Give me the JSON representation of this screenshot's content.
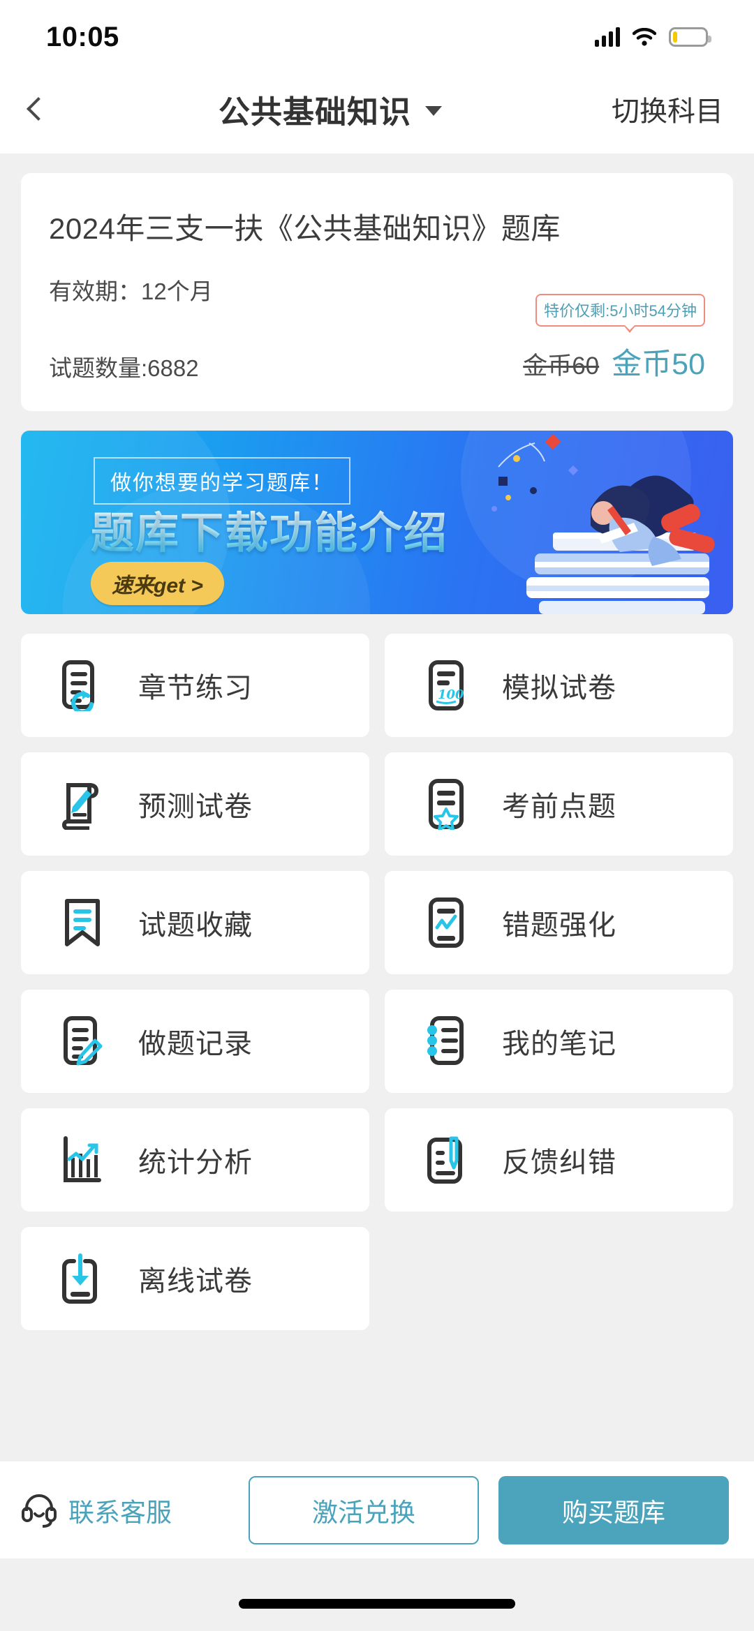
{
  "status_bar": {
    "time": "10:05",
    "signal_icon": "signal-bars-icon",
    "wifi_icon": "wifi-icon",
    "battery_icon": "battery-low-icon"
  },
  "nav": {
    "back_icon": "chevron-left-icon",
    "title": "公共基础知识",
    "dropdown_icon": "caret-down-icon",
    "action_label": "切换科目"
  },
  "info_card": {
    "title": "2024年三支一扶《公共基础知识》题库",
    "validity": "有效期：12个月",
    "question_count": "试题数量:6882",
    "promo_badge": "特价仅剩:5小时54分钟",
    "price_original": "金币60",
    "price_current": "金币50"
  },
  "banner": {
    "tagline": "做你想要的学习题库！",
    "title": "题库下载功能介绍",
    "cta": "速来get >",
    "illustration": "person-studying-on-books-illustration"
  },
  "grid": {
    "items": [
      {
        "label": "章节练习",
        "icon": "document-refresh-icon"
      },
      {
        "label": "模拟试卷",
        "icon": "document-score-100-icon"
      },
      {
        "label": "预测试卷",
        "icon": "scroll-pen-icon"
      },
      {
        "label": "考前点题",
        "icon": "document-star-icon"
      },
      {
        "label": "试题收藏",
        "icon": "bookmark-lines-icon"
      },
      {
        "label": "错题强化",
        "icon": "document-checkline-icon"
      },
      {
        "label": "做题记录",
        "icon": "document-pencil-icon"
      },
      {
        "label": "我的笔记",
        "icon": "notebook-spiral-icon"
      },
      {
        "label": "统计分析",
        "icon": "bar-chart-trend-icon"
      },
      {
        "label": "反馈纠错",
        "icon": "document-pen-feedback-icon"
      },
      {
        "label": "离线试卷",
        "icon": "download-document-icon"
      }
    ]
  },
  "bottom_bar": {
    "service_icon": "headset-icon",
    "service_label": "联系客服",
    "activate_label": "激活兑换",
    "buy_label": "购买题库"
  },
  "colors": {
    "accent_teal": "#4aa3bb",
    "icon_cyan": "#29c5e8",
    "icon_dark": "#333333",
    "banner_blue_left": "#14b4ef",
    "banner_blue_right": "#3a5ff0",
    "promo_border": "#f08b80",
    "page_bg": "#f0f0f0"
  }
}
